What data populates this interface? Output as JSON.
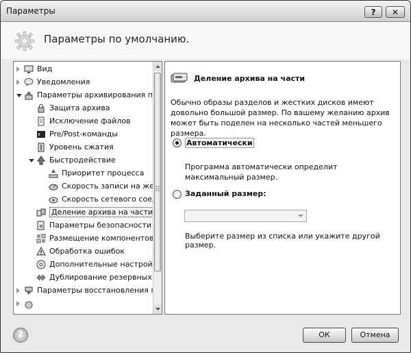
{
  "window": {
    "title": "Параметры",
    "help_label": "?",
    "close_label": "✕"
  },
  "header": {
    "title": "Параметры по умолчанию."
  },
  "tree": {
    "items": [
      {
        "label": "Вид",
        "icon": "monitor-icon",
        "indent": 0,
        "twisty": "closed"
      },
      {
        "label": "Уведомления",
        "icon": "chat-icon",
        "indent": 0,
        "twisty": "closed"
      },
      {
        "label": "Параметры архивирования по умолчанию",
        "icon": "archive-upload-icon",
        "indent": 0,
        "twisty": "open"
      },
      {
        "label": "Защита архива",
        "icon": "lock-icon",
        "indent": 1,
        "twisty": "none"
      },
      {
        "label": "Исключение файлов",
        "icon": "file-exclude-icon",
        "indent": 1,
        "twisty": "none"
      },
      {
        "label": "Pre/Post-команды",
        "icon": "console-icon",
        "indent": 1,
        "twisty": "none"
      },
      {
        "label": "Уровень сжатия",
        "icon": "compression-icon",
        "indent": 1,
        "twisty": "none"
      },
      {
        "label": "Быстродействие",
        "icon": "performance-icon",
        "indent": 1,
        "twisty": "open"
      },
      {
        "label": "Приоритет процесса",
        "icon": "priority-icon",
        "indent": 2,
        "twisty": "none"
      },
      {
        "label": "Скорость записи на жесткий диск",
        "icon": "disk-speed-icon",
        "indent": 2,
        "twisty": "none"
      },
      {
        "label": "Скорость сетевого соединения",
        "icon": "network-speed-icon",
        "indent": 2,
        "twisty": "none"
      },
      {
        "label": "Деление архива на части",
        "icon": "split-archive-icon",
        "indent": 1,
        "twisty": "none",
        "selected": true
      },
      {
        "label": "Параметры безопасности файлов",
        "icon": "file-security-icon",
        "indent": 1,
        "twisty": "none"
      },
      {
        "label": "Размещение компонентов",
        "icon": "components-icon",
        "indent": 1,
        "twisty": "none"
      },
      {
        "label": "Обработка ошибок",
        "icon": "warning-icon",
        "indent": 1,
        "twisty": "none"
      },
      {
        "label": "Дополнительные настройки",
        "icon": "disc-icon",
        "indent": 1,
        "twisty": "none"
      },
      {
        "label": "Дублирование резервных копий",
        "icon": "duplicate-icon",
        "indent": 1,
        "twisty": "none"
      },
      {
        "label": "Параметры восстановления по умолчанию",
        "icon": "restore-icon",
        "indent": 0,
        "twisty": "closed"
      },
      {
        "label": "",
        "icon": "partial-icon",
        "indent": 0,
        "twisty": "closed"
      }
    ]
  },
  "panel": {
    "title": "Деление архива на части",
    "description": "Обычно образы разделов и жестких дисков имеют довольно большой размер. По вашему желанию архив может быть поделен на несколько частей меньшего размера.",
    "auto_label": "Автоматически",
    "auto_description": "Программа автоматически определит максимальный размер.",
    "custom_label": "Заданный размер:",
    "size_value": "",
    "size_hint": "Выберите размер из списка или укажите другой размер."
  },
  "buttons": {
    "ok": "ОК",
    "cancel": "Отмена"
  }
}
